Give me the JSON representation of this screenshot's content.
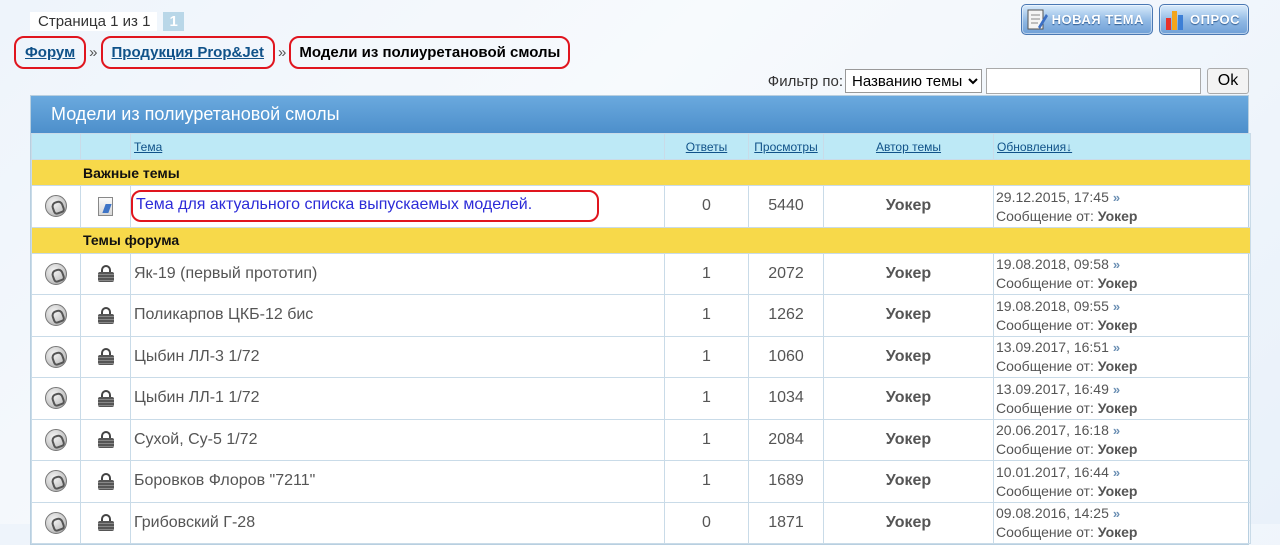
{
  "pager": {
    "text": "Страница 1 из 1",
    "current": "1"
  },
  "buttons": {
    "new_topic": "НОВАЯ ТЕМА",
    "poll": "ОПРОС"
  },
  "breadcrumb": {
    "forum": "Форум",
    "product": "Продукция Prop&Jet",
    "sep": "»",
    "current": "Модели из полиуретановой смолы"
  },
  "filter": {
    "label": "Фильтр по:",
    "selected": "Названию темы",
    "search_value": "",
    "ok": "Ok"
  },
  "forum": {
    "title": "Модели из полиуретановой смолы",
    "columns": {
      "topic": "Тема",
      "replies": "Ответы",
      "views": "Просмотры",
      "author": "Автор темы",
      "updates": "Обновления↓"
    },
    "sections": {
      "important": "Важные темы",
      "forum_topics": "Темы форума"
    },
    "msg_from": "Сообщение от:",
    "sticky": {
      "title": "Тема для актуального списка выпускаемых моделей.",
      "replies": "0",
      "views": "5440",
      "author": "Уокер",
      "date": "29.12.2015, 17:45",
      "last": "Уокер"
    },
    "topics": [
      {
        "title": "Як-19 (первый прототип)",
        "replies": "1",
        "views": "2072",
        "author": "Уокер",
        "date": "19.08.2018, 09:58",
        "last": "Уокер"
      },
      {
        "title": "Поликарпов ЦКБ-12 бис",
        "replies": "1",
        "views": "1262",
        "author": "Уокер",
        "date": "19.08.2018, 09:55",
        "last": "Уокер"
      },
      {
        "title": "Цыбин ЛЛ-3 1/72",
        "replies": "1",
        "views": "1060",
        "author": "Уокер",
        "date": "13.09.2017, 16:51",
        "last": "Уокер"
      },
      {
        "title": "Цыбин ЛЛ-1 1/72",
        "replies": "1",
        "views": "1034",
        "author": "Уокер",
        "date": "13.09.2017, 16:49",
        "last": "Уокер"
      },
      {
        "title": "Сухой, Су-5 1/72",
        "replies": "1",
        "views": "2084",
        "author": "Уокер",
        "date": "20.06.2017, 16:18",
        "last": "Уокер"
      },
      {
        "title": "Боровков Флоров \"7211\"",
        "replies": "1",
        "views": "1689",
        "author": "Уокер",
        "date": "10.01.2017, 16:44",
        "last": "Уокер"
      },
      {
        "title": "Грибовский Г-28",
        "replies": "0",
        "views": "1871",
        "author": "Уокер",
        "date": "09.08.2016, 14:25",
        "last": "Уокер"
      }
    ]
  },
  "colors": {
    "header_blue": "#5a9ed6",
    "section_yellow": "#f7d94a",
    "column_head": "#bde9f6",
    "annotation_red": "#e0151e"
  }
}
